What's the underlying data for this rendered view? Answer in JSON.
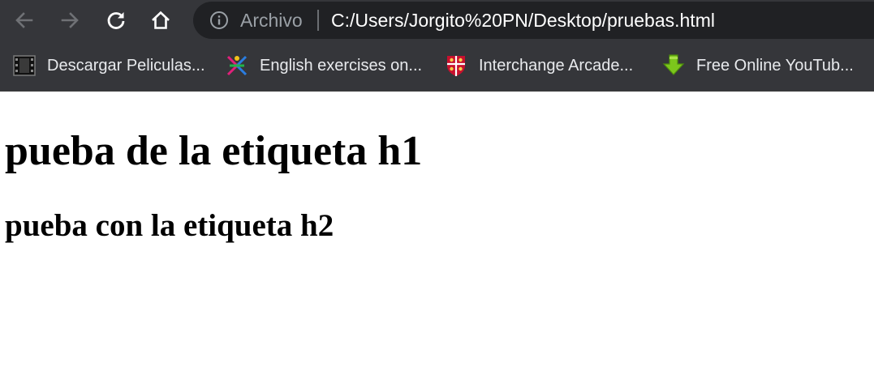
{
  "toolbar": {
    "back_icon": "arrow-left-icon",
    "forward_icon": "arrow-right-icon",
    "reload_icon": "reload-icon",
    "home_icon": "home-icon",
    "omnibox": {
      "info_icon": "info-icon",
      "scheme_label": "Archivo",
      "url": "C:/Users/Jorgito%20PN/Desktop/pruebas.html"
    },
    "icon_colors": {
      "back": "#6f7175",
      "forward": "#6f7175",
      "reload": "#ffffff",
      "home": "#ffffff"
    }
  },
  "bookmarks": [
    {
      "label": "Descargar Peliculas...",
      "icon": "film-strip-icon"
    },
    {
      "label": "English exercises on...",
      "icon": "colorful-figure-icon"
    },
    {
      "label": "Interchange Arcade...",
      "icon": "university-crest-icon"
    },
    {
      "label": "Free Online YouTub...",
      "icon": "green-download-arrow-icon"
    }
  ],
  "page": {
    "h1": "pueba de la etiqueta h1",
    "h2": "pueba con la etiqueta h2"
  },
  "colors": {
    "chrome_bg": "#35363a",
    "omnibox_bg": "#202124",
    "page_bg": "#ffffff"
  }
}
